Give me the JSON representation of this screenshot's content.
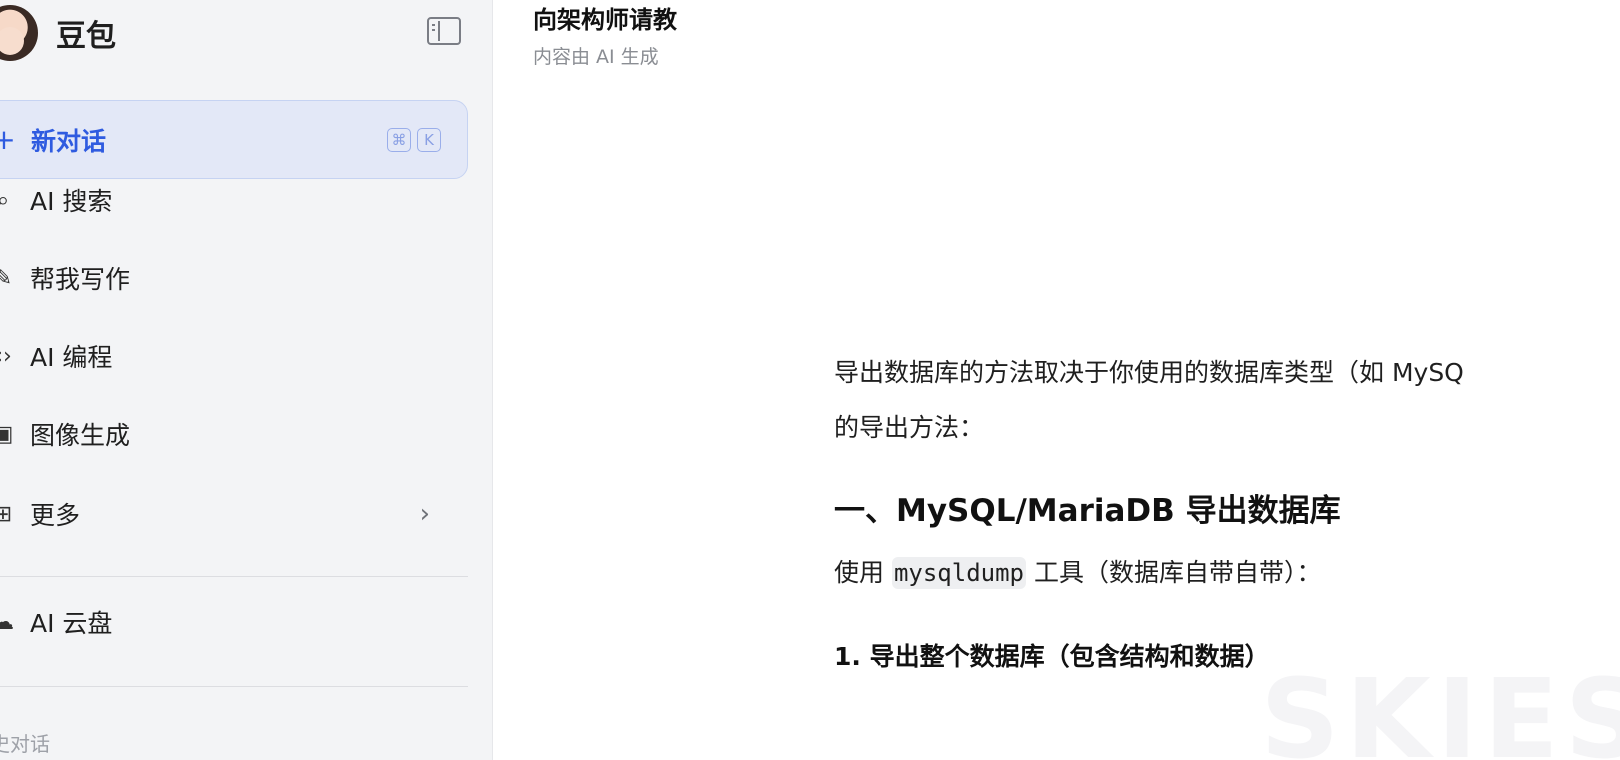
{
  "sidebar": {
    "brand_name": "豆包",
    "new_chat": {
      "label": "新对话",
      "shortcut": [
        "⌘",
        "K"
      ]
    },
    "items": [
      {
        "label": "AI 搜索",
        "icon": "search-icon"
      },
      {
        "label": "帮我写作",
        "icon": "pen-icon"
      },
      {
        "label": "AI 编程",
        "icon": "code-icon"
      },
      {
        "label": "图像生成",
        "icon": "image-icon"
      },
      {
        "label": "更多",
        "icon": "apps-icon"
      },
      {
        "label": "AI 云盘",
        "icon": "cloud-icon"
      }
    ],
    "history_label": "史对话"
  },
  "header": {
    "title": "向架构师请教",
    "subtitle": "内容由 AI 生成"
  },
  "answer": {
    "intro_line1": "导出数据库的方法取决于你使用的数据库类型（如 MySQ",
    "intro_line2": "的导出方法：",
    "heading1": "一、MySQL/MariaDB 导出数据库",
    "use_prefix": "使用 ",
    "use_code": "mysqldump",
    "use_suffix": " 工具（数据库自带自带）：",
    "subheading1": "1. 导出整个数据库（包含结构和数据）"
  },
  "watermark": "SKIES",
  "colors": {
    "accent": "#2f5be0",
    "sidebar_bg": "#f3f4f6",
    "new_chat_bg": "#e3e8f7"
  }
}
